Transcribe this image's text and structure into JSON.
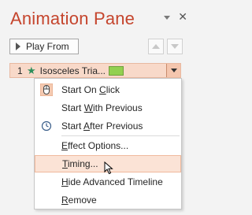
{
  "pane": {
    "title": "Animation Pane",
    "play_from_label": "Play From"
  },
  "animation_item": {
    "order": "1",
    "name": "Isosceles Tria..."
  },
  "menu": {
    "items": [
      {
        "pre": "Start On ",
        "key": "C",
        "post": "lick"
      },
      {
        "pre": "Start ",
        "key": "W",
        "post": "ith Previous"
      },
      {
        "pre": "Start ",
        "key": "A",
        "post": "fter Previous"
      },
      {
        "pre": "",
        "key": "E",
        "post": "ffect Options..."
      },
      {
        "pre": "",
        "key": "T",
        "post": "iming..."
      },
      {
        "pre": "",
        "key": "H",
        "post": "ide Advanced Timeline"
      },
      {
        "pre": "",
        "key": "R",
        "post": "emove"
      }
    ]
  },
  "colors": {
    "title": "#c5452d",
    "selected_row": "#f8d9c9",
    "timeline_bar": "#92d050",
    "star": "#2f8f5c",
    "menu_highlight": "#fbe3d6"
  },
  "icons": {
    "start_on_click": "mouse-click-icon",
    "start_after_previous": "clock-icon",
    "entrance_effect": "star-icon"
  }
}
